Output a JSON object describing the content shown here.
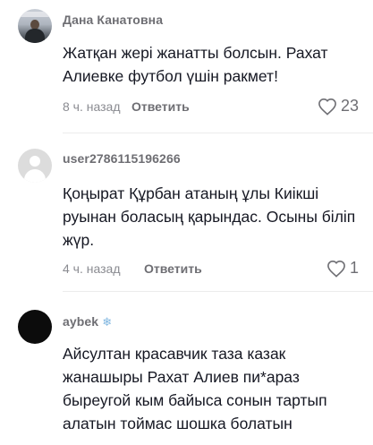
{
  "comments": [
    {
      "username": "Дана Канатовна",
      "text": "Жатқан жері жанатты болсын. Рахат Алиевке футбол үшін ракмет!",
      "time": "8 ч. назад",
      "reply_label": "Ответить",
      "likes": "23",
      "avatar": "photo"
    },
    {
      "username": "user2786115196266",
      "text": "Қоңырат Құрбан атаның ұлы Киікші руынан боласың қарындас. Осыны біліп жүр.",
      "time": "4 ч. назад",
      "reply_label": "Ответить",
      "likes": "1",
      "avatar": "default"
    },
    {
      "username": "aybek",
      "username_icon": "❄",
      "text": "Айсултан красавчик таза казак жанашыры Рахат Алиев пи*араз быреугой кым байыса сонын тартып алатын тоймас шошка болатын",
      "avatar": "dark"
    }
  ],
  "colors": {
    "text": "#161823",
    "secondary": "#6e6e73",
    "muted": "#8a8b91",
    "snowflake": "#7fb6e0"
  }
}
